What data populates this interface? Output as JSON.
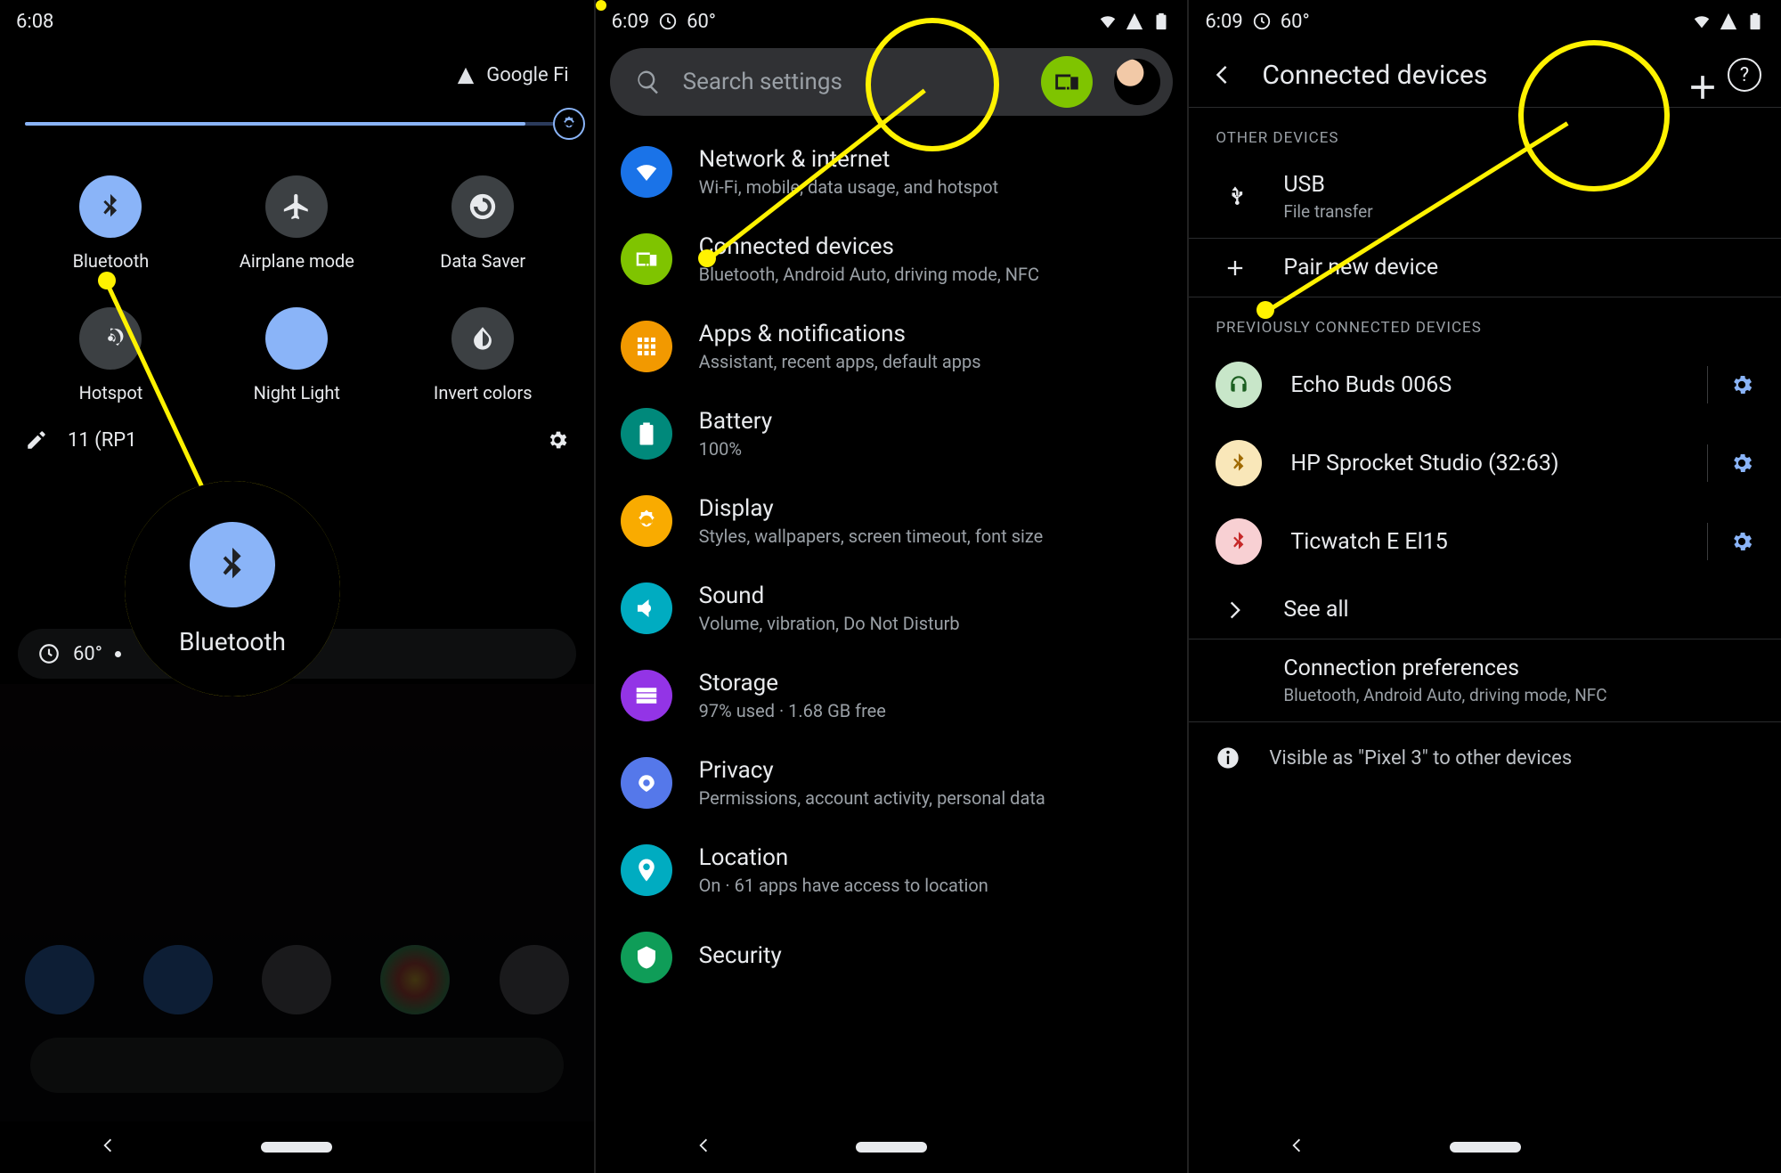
{
  "phone1": {
    "status_time": "6:08",
    "carrier": "Google Fi",
    "tiles": [
      {
        "label": "Bluetooth",
        "icon": "bluetooth",
        "on": true
      },
      {
        "label": "Airplane mode",
        "icon": "airplane",
        "on": false
      },
      {
        "label": "Data Saver",
        "icon": "datasaver",
        "on": false
      },
      {
        "label": "Hotspot",
        "icon": "hotspot",
        "on": false
      },
      {
        "label": "Night Light",
        "icon": "nightlight",
        "on": true
      },
      {
        "label": "Invert colors",
        "icon": "invert",
        "on": false
      }
    ],
    "build_label": "11 (RP1",
    "media_temp": "60°",
    "callout_label": "Bluetooth"
  },
  "phone2": {
    "status_time": "6:09",
    "status_temp": "60°",
    "search_placeholder": "Search settings",
    "items": [
      {
        "title": "Network & internet",
        "subtitle": "Wi-Fi, mobile, data usage, and hotspot",
        "color": "c-net",
        "icon": "wifi"
      },
      {
        "title": "Connected devices",
        "subtitle": "Bluetooth, Android Auto, driving mode, NFC",
        "color": "c-conn",
        "icon": "devices"
      },
      {
        "title": "Apps & notifications",
        "subtitle": "Assistant, recent apps, default apps",
        "color": "c-apps",
        "icon": "apps"
      },
      {
        "title": "Battery",
        "subtitle": "100%",
        "color": "c-bat",
        "icon": "battery"
      },
      {
        "title": "Display",
        "subtitle": "Styles, wallpapers, screen timeout, font size",
        "color": "c-disp",
        "icon": "display"
      },
      {
        "title": "Sound",
        "subtitle": "Volume, vibration, Do Not Disturb",
        "color": "c-sound",
        "icon": "sound"
      },
      {
        "title": "Storage",
        "subtitle": "97% used · 1.68 GB free",
        "color": "c-stor",
        "icon": "storage"
      },
      {
        "title": "Privacy",
        "subtitle": "Permissions, account activity, personal data",
        "color": "c-priv",
        "icon": "privacy"
      },
      {
        "title": "Location",
        "subtitle": "On · 61 apps have access to location",
        "color": "c-loc",
        "icon": "location"
      },
      {
        "title": "Security",
        "subtitle": "",
        "color": "c-sec",
        "icon": "security"
      }
    ]
  },
  "phone3": {
    "status_time": "6:09",
    "status_temp": "60°",
    "title": "Connected devices",
    "section_other": "OTHER DEVICES",
    "usb_title": "USB",
    "usb_sub": "File transfer",
    "pair_label": "Pair new device",
    "section_prev": "PREVIOUSLY CONNECTED DEVICES",
    "devices": [
      {
        "name": "Echo Buds 006S",
        "kind": "echo"
      },
      {
        "name": "HP Sprocket Studio (32:63)",
        "kind": "hp"
      },
      {
        "name": "Ticwatch E El15",
        "kind": "tic"
      }
    ],
    "see_all": "See all",
    "conn_pref_title": "Connection preferences",
    "conn_pref_sub": "Bluetooth, Android Auto, driving mode, NFC",
    "visible": "Visible as \"Pixel 3\" to other devices"
  }
}
